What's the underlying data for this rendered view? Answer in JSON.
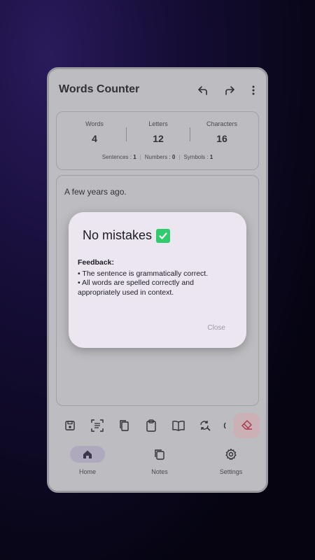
{
  "app": {
    "title": "Words Counter",
    "undo_icon": "undo-arrow-icon",
    "redo_icon": "redo-arrow-icon",
    "menu_icon": "more-vert-icon"
  },
  "stats": {
    "words_label": "Words",
    "words_value": "4",
    "letters_label": "Letters",
    "letters_value": "12",
    "characters_label": "Characters",
    "characters_value": "16",
    "sentences_label": "Sentences :",
    "sentences_value": "1",
    "numbers_label": "Numbers :",
    "numbers_value": "0",
    "symbols_label": "Symbols :",
    "symbols_value": "1"
  },
  "editor": {
    "text": "A few years ago."
  },
  "toolbar": {
    "icons": [
      "save-icon",
      "scan-text-icon",
      "copy-icon",
      "paste-icon",
      "dictionary-icon",
      "find-replace-icon",
      "spell-check-icon",
      "eraser-icon"
    ]
  },
  "nav": {
    "items": [
      {
        "label": "Home",
        "icon": "home-icon"
      },
      {
        "label": "Notes",
        "icon": "notes-icon"
      },
      {
        "label": "Settings",
        "icon": "settings-gear-icon"
      }
    ]
  },
  "dialog": {
    "title": "No mistakes",
    "title_icon": "green-check-icon",
    "feedback_heading": "Feedback:",
    "feedback_line1": "• The sentence is grammatically correct.",
    "feedback_line2": "• All words are spelled correctly and appropriately used in context.",
    "close_label": "Close"
  },
  "colors": {
    "accent_check": "#2fcb6d",
    "dialog_bg": "#ece6f1",
    "eraser_bg": "#d9b9bf"
  }
}
